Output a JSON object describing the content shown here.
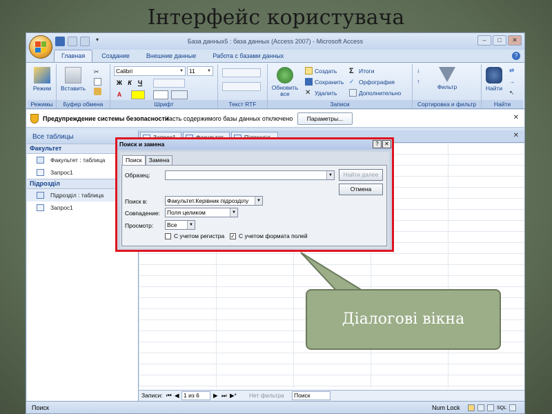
{
  "slide": {
    "title": "Інтерфейс користувача",
    "callout": "Діалогові вікна"
  },
  "window": {
    "title": "База данных5 : база данных (Access 2007) - Microsoft Access"
  },
  "ribbon_tabs": [
    "Главная",
    "Создание",
    "Внешние данные",
    "Работа с базами данных"
  ],
  "ribbon": {
    "groups": [
      "Режимы",
      "Буфер обмена",
      "Шрифт",
      "Текст RTF",
      "Записи",
      "Сортировка и фильтр",
      "Найти"
    ],
    "mode_label": "Режим",
    "paste_label": "Вставить",
    "font_name": "Calibri",
    "font_size": "11",
    "bold": "Ж",
    "italic": "К",
    "underline": "Ч",
    "refresh_label": "Обновить все",
    "records": {
      "create": "Создать",
      "save": "Сохранить",
      "delete": "Удалить",
      "totals": "Итоги",
      "spelling": "Орфография",
      "more": "Дополнительно"
    },
    "filter_label": "Фильтр",
    "find_label": "Найти"
  },
  "security_bar": {
    "title": "Предупреждение системы безопасности",
    "text": "Часть содержимого базы данных отключено",
    "button": "Параметры..."
  },
  "nav": {
    "header": "Все таблицы",
    "groups": [
      {
        "name": "Факультет",
        "items": [
          "Факультет : таблица",
          "Запрос1"
        ]
      },
      {
        "name": "Підрозділ",
        "items": [
          "Підрозділ : таблица",
          "Запрос1"
        ]
      }
    ]
  },
  "doc_tabs": [
    "Запрос1",
    "Факультет",
    "Підрозділ"
  ],
  "dialog": {
    "title": "Поиск и замена",
    "tabs": [
      "Поиск",
      "Замена"
    ],
    "sample_label": "Образец:",
    "sample_value": "",
    "find_next": "Найти далее",
    "cancel": "Отмена",
    "look_in_label": "Поиск в:",
    "look_in_value": "Факультет.Керівник підрозділу",
    "match_label": "Совпадение:",
    "match_value": "Поля целиком",
    "search_label": "Просмотр:",
    "search_value": "Все",
    "match_case": "С учетом регистра",
    "match_case_checked": false,
    "format_fields": "С учетом формата полей",
    "format_fields_checked": true
  },
  "record_nav": {
    "label": "Записи:",
    "position": "1 из 6",
    "filter": "Нет фильтра",
    "search": "Поиск"
  },
  "status": {
    "left": "Поиск",
    "num_lock": "Num Lock",
    "sql": "SQL"
  },
  "colors": {
    "dialog_highlight": "#e0141e",
    "callout_bg": "#9cae88",
    "ribbon_text": "#15428b"
  }
}
